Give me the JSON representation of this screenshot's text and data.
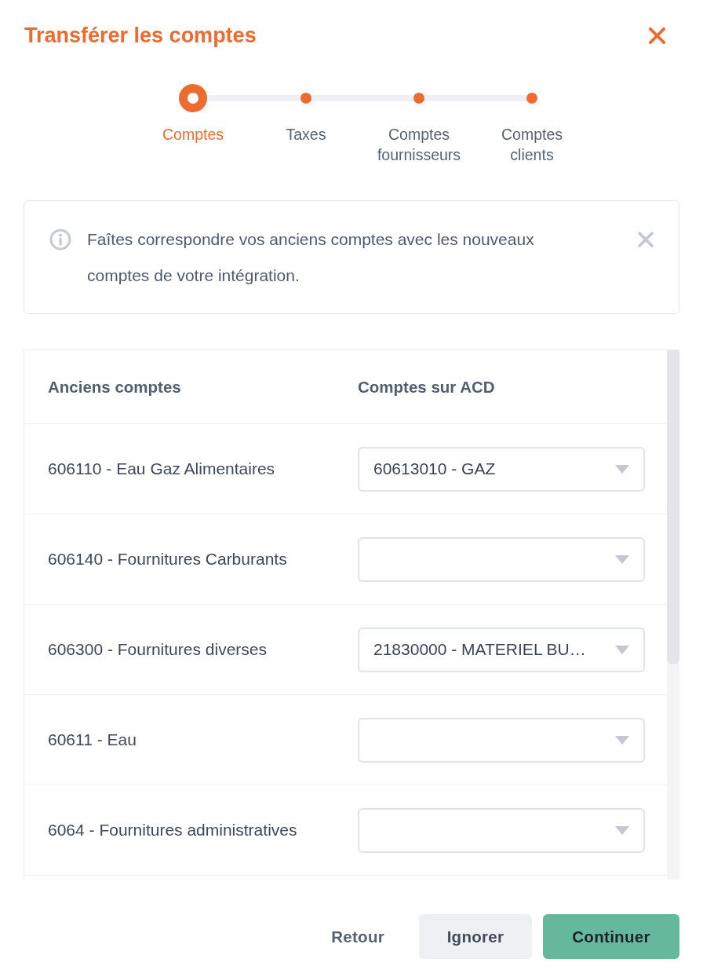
{
  "dialog": {
    "title": "Transférer les comptes"
  },
  "steps": [
    {
      "label": "Comptes",
      "current": true
    },
    {
      "label": "Taxes",
      "current": false
    },
    {
      "label": "Comptes fournisseurs",
      "current": false
    },
    {
      "label": "Comptes clients",
      "current": false
    }
  ],
  "info": {
    "message": "Faîtes correspondre vos anciens comptes avec les nouveaux comptes de votre intégration."
  },
  "table": {
    "columns": [
      "Anciens comptes",
      "Comptes sur ACD"
    ],
    "rows": [
      {
        "old_account": "606110 - Eau Gaz Alimentaires",
        "acd_account": "60613010 - GAZ"
      },
      {
        "old_account": "606140 - Fournitures Carburants"
      },
      {
        "old_account": "606300 - Fournitures diverses",
        "acd_account": "21830000 - MATERIEL BU…"
      },
      {
        "old_account": "60611 - Eau"
      },
      {
        "old_account": "6064 - Fournitures administratives"
      }
    ]
  },
  "buttons": [
    {
      "label": "Retour",
      "kind": "text"
    },
    {
      "label": "Ignorer",
      "kind": "secondary"
    },
    {
      "label": "Continuer",
      "kind": "primary"
    }
  ]
}
